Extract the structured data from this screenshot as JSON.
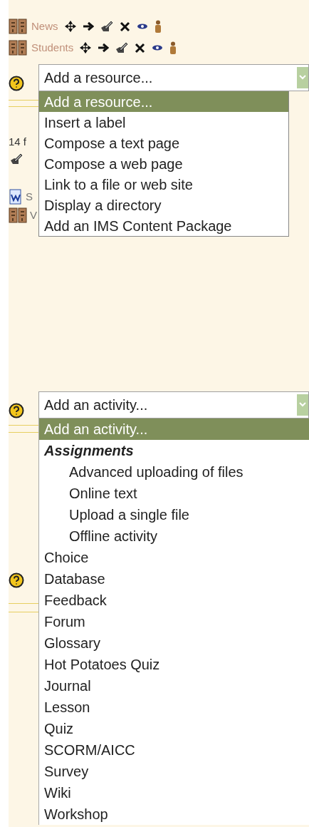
{
  "module_rows": [
    {
      "name": "News"
    },
    {
      "name": "Students"
    }
  ],
  "resource_select": {
    "value": "Add a resource...",
    "options": [
      {
        "label": "Add a resource...",
        "selected": true
      },
      {
        "label": "Insert a label",
        "selected": false
      },
      {
        "label": "Compose a text page",
        "selected": false
      },
      {
        "label": "Compose a web page",
        "selected": false
      },
      {
        "label": "Link to a file or web site",
        "selected": false
      },
      {
        "label": "Display a directory",
        "selected": false
      },
      {
        "label": "Add an IMS Content Package",
        "selected": false
      }
    ]
  },
  "background_texts": [
    "14 f",
    "S",
    "V"
  ],
  "activity_select": {
    "value": "Add an activity...",
    "options": [
      {
        "label": "Add an activity...",
        "kind": "option",
        "selected": true
      },
      {
        "label": "Assignments",
        "kind": "group",
        "children": [
          {
            "label": "Advanced uploading of files",
            "selected": false
          },
          {
            "label": "Online text",
            "selected": false
          },
          {
            "label": "Upload a single file",
            "selected": false
          },
          {
            "label": "Offline activity",
            "selected": false
          }
        ]
      },
      {
        "label": "Choice",
        "kind": "option",
        "selected": false
      },
      {
        "label": "Database",
        "kind": "option",
        "selected": false
      },
      {
        "label": "Feedback",
        "kind": "option",
        "selected": false
      },
      {
        "label": "Forum",
        "kind": "option",
        "selected": false
      },
      {
        "label": "Glossary",
        "kind": "option",
        "selected": false
      },
      {
        "label": "Hot Potatoes Quiz",
        "kind": "option",
        "selected": false
      },
      {
        "label": "Journal",
        "kind": "option",
        "selected": false
      },
      {
        "label": "Lesson",
        "kind": "option",
        "selected": false
      },
      {
        "label": "Quiz",
        "kind": "option",
        "selected": false
      },
      {
        "label": "SCORM/AICC",
        "kind": "option",
        "selected": false
      },
      {
        "label": "Survey",
        "kind": "option",
        "selected": false
      },
      {
        "label": "Wiki",
        "kind": "option",
        "selected": false
      },
      {
        "label": "Workshop",
        "kind": "option",
        "selected": false
      }
    ]
  }
}
